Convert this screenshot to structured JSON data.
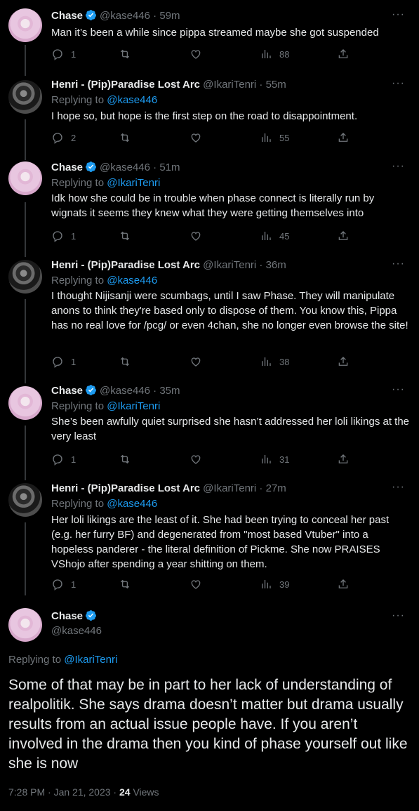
{
  "tweets": [
    {
      "name": "Chase",
      "verified": true,
      "handle": "@kase446",
      "time": "· 59m",
      "reply_to_label": "",
      "reply_to_user": "",
      "text": "Man it’s been a while since pippa streamed maybe she got suspended",
      "replies": "1",
      "retweets": "",
      "likes": "",
      "views": "88"
    },
    {
      "name": "Henri - (Pip)Paradise Lost Arc",
      "verified": false,
      "handle": "@IkariTenri",
      "time": "· 55m",
      "reply_to_label": "Replying to",
      "reply_to_user": "@kase446",
      "text": "I hope so, but hope is the first step on the road to disappointment.",
      "replies": "2",
      "retweets": "",
      "likes": "",
      "views": "55"
    },
    {
      "name": "Chase",
      "verified": true,
      "handle": "@kase446",
      "time": "· 51m",
      "reply_to_label": "Replying to",
      "reply_to_user": "@IkariTenri",
      "text": "Idk how she could be in trouble when phase connect is literally run by wignats it seems they knew what they were getting themselves into",
      "replies": "1",
      "retweets": "",
      "likes": "",
      "views": "45"
    },
    {
      "name": "Henri - (Pip)Paradise Lost Arc",
      "verified": false,
      "handle": "@IkariTenri",
      "time": "· 36m",
      "reply_to_label": "Replying to",
      "reply_to_user": "@kase446",
      "text": "I thought Nijisanji were scumbags, until I saw Phase. They will manipulate anons to think they're based only to dispose of them. You know this, Pippa has no real love for /pcg/ or even 4chan, she no longer even browse the site!",
      "replies": "1",
      "retweets": "",
      "likes": "",
      "views": "38"
    },
    {
      "name": "Chase",
      "verified": true,
      "handle": "@kase446",
      "time": "· 35m",
      "reply_to_label": "Replying to",
      "reply_to_user": "@IkariTenri",
      "text": "She’s been awfully quiet surprised she hasn’t addressed her loli likings at the very least",
      "replies": "1",
      "retweets": "",
      "likes": "",
      "views": "31"
    },
    {
      "name": "Henri - (Pip)Paradise Lost Arc",
      "verified": false,
      "handle": "@IkariTenri",
      "time": "· 27m",
      "reply_to_label": "Replying to",
      "reply_to_user": "@kase446",
      "text": "Her loli likings are the least of it. She had been trying to conceal her past (e.g. her furry BF) and degenerated from \"most based Vtuber\" into a hopeless panderer - the literal definition of Pickme. She now PRAISES VShojo after spending a year shitting on them.",
      "replies": "1",
      "retweets": "",
      "likes": "",
      "views": "39"
    }
  ],
  "main": {
    "name": "Chase",
    "handle": "@kase446",
    "reply_to_label": "Replying to",
    "reply_to_user": "@IkariTenri",
    "text": "Some of that may be in part to her lack of understanding of realpolitik. She says drama doesn’t matter but drama usually results from an actual issue people have. If you aren’t involved in the drama then you kind of phase yourself out like she is now",
    "timestamp": "7:28 PM · Jan 21, 2023 ·",
    "views_count": "24",
    "views_label": "Views"
  },
  "colors": {
    "background": "#000000",
    "text": "#e7e9ea",
    "muted": "#71767b",
    "link": "#1d9bf0",
    "verified": "#1d9bf0"
  },
  "icons": [
    "reply-icon",
    "retweet-icon",
    "like-icon",
    "views-icon",
    "share-icon",
    "more-icon",
    "verified-badge-icon"
  ]
}
